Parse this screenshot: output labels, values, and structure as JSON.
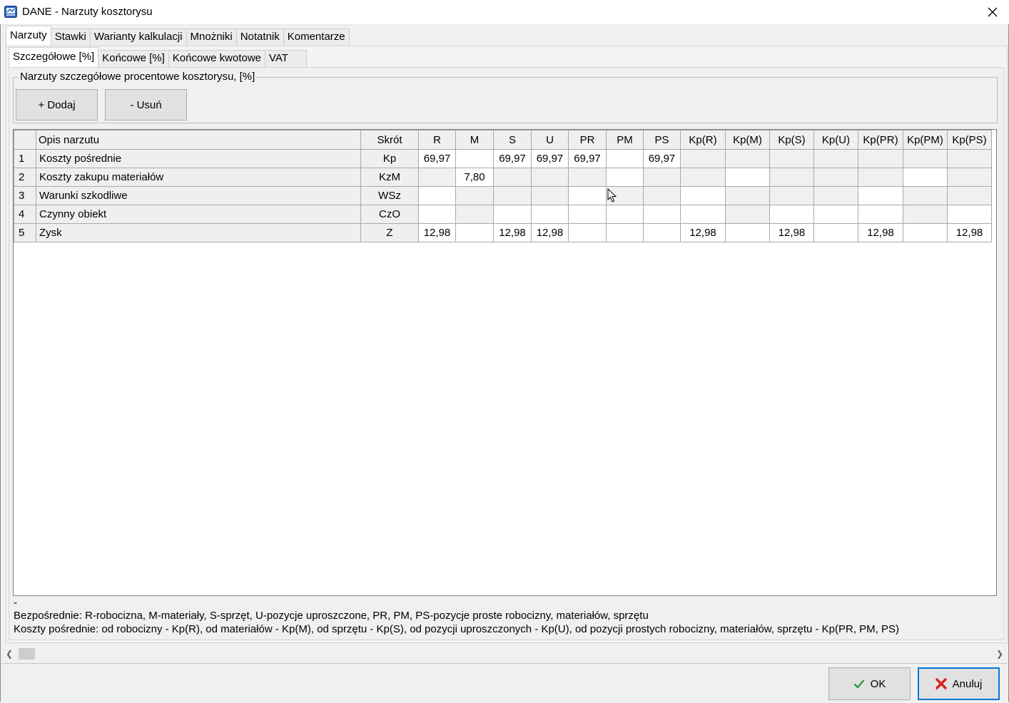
{
  "window": {
    "title": "DANE - Narzuty kosztorysu"
  },
  "main_tabs": [
    {
      "label": "Narzuty",
      "active": true
    },
    {
      "label": "Stawki",
      "active": false
    },
    {
      "label": "Warianty kalkulacji",
      "active": false
    },
    {
      "label": "Mnożniki",
      "active": false
    },
    {
      "label": "Notatnik",
      "active": false
    },
    {
      "label": "Komentarze",
      "active": false
    }
  ],
  "sub_tabs": [
    {
      "label": "Szczegółowe [%]",
      "active": true
    },
    {
      "label": "Końcowe [%]",
      "active": false
    },
    {
      "label": "Końcowe kwotowe",
      "active": false
    },
    {
      "label": "VAT",
      "active": false
    }
  ],
  "group": {
    "title": "Narzuty szczegółowe procentowe kosztorysu, [%]",
    "add_label": "+ Dodaj",
    "remove_label": "- Usuń"
  },
  "grid": {
    "columns": [
      "",
      "Opis narzutu",
      "Skrót",
      "R",
      "M",
      "S",
      "U",
      "PR",
      "PM",
      "PS",
      "Kp(R)",
      "Kp(M)",
      "Kp(S)",
      "Kp(U)",
      "Kp(PR)",
      "Kp(PM)",
      "Kp(PS)"
    ],
    "rows": [
      {
        "no": "1",
        "desc": "Koszty pośrednie",
        "abbr": "Kp",
        "values": [
          "69,97",
          "",
          "69,97",
          "69,97",
          "69,97",
          "",
          "69,97",
          "",
          "",
          "",
          "",
          "",
          "",
          ""
        ]
      },
      {
        "no": "2",
        "desc": "Koszty zakupu materiałów",
        "abbr": "KzM",
        "values": [
          "",
          "7,80",
          "",
          "",
          "",
          "",
          "",
          "",
          "",
          "",
          "",
          "",
          "",
          ""
        ]
      },
      {
        "no": "3",
        "desc": "Warunki szkodliwe",
        "abbr": "WSz",
        "values": [
          "",
          "",
          "",
          "",
          "",
          "",
          "",
          "",
          "",
          "",
          "",
          "",
          "",
          ""
        ]
      },
      {
        "no": "4",
        "desc": "Czynny obiekt",
        "abbr": "CzO",
        "values": [
          "",
          "",
          "",
          "",
          "",
          "",
          "",
          "",
          "",
          "",
          "",
          "",
          "",
          ""
        ]
      },
      {
        "no": "5",
        "desc": "Zysk",
        "abbr": "Z",
        "values": [
          "12,98",
          "",
          "12,98",
          "12,98",
          "",
          "",
          "",
          "12,98",
          "",
          "12,98",
          "",
          "12,98",
          "",
          "12,98"
        ]
      }
    ]
  },
  "legend": {
    "dash": "-",
    "line1": "Bezpośrednie: R-robocizna, M-materiały, S-sprzęt, U-pozycje uproszczone, PR, PM, PS-pozycje proste robocizny, materiałów, sprzętu",
    "line2": "Koszty pośrednie: od robocizny - Kp(R), od materiałów - Kp(M), od sprzętu - Kp(S), od pozycji uproszczonych - Kp(U), od pozycji prostych robocizny, materiałów, sprzętu - Kp(PR, PM, PS)"
  },
  "footer": {
    "ok_label": "OK",
    "cancel_label": "Anuluj"
  },
  "colors": {
    "ok_check": "#2e9a3e",
    "cancel_x": "#d8231c",
    "focus_border": "#0078d7"
  },
  "icons": [
    "app-icon",
    "close-icon",
    "check-icon",
    "cancel-x-icon",
    "scroll-left-icon",
    "scroll-right-icon",
    "mouse-cursor-icon"
  ]
}
